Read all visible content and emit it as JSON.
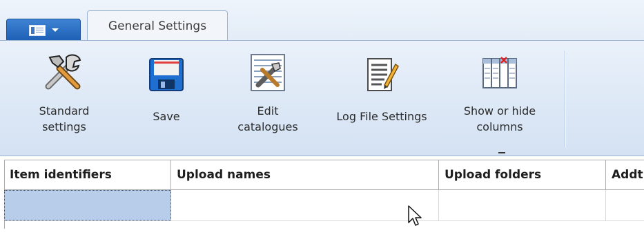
{
  "tabs": {
    "app_menu_icon": "document-list-icon",
    "active_tab": "General Settings"
  },
  "ribbon": {
    "buttons": [
      {
        "icon": "tools-icon",
        "label": "Standard\nsettings"
      },
      {
        "icon": "floppy-disk-icon",
        "label": "Save"
      },
      {
        "icon": "edit-catalogue-icon",
        "label": "Edit\ncatalogues"
      },
      {
        "icon": "log-file-icon",
        "label": "Log File Settings"
      },
      {
        "icon": "columns-icon",
        "label": "Show or hide\ncolumns"
      }
    ]
  },
  "grid": {
    "columns": [
      "Item identifiers",
      "Upload names",
      "Upload folders",
      "Addt"
    ]
  },
  "colors": {
    "ribbon_bg": "#dde8f6",
    "app_button": "#2b6cc4",
    "selected_cell": "#b8cde9"
  }
}
